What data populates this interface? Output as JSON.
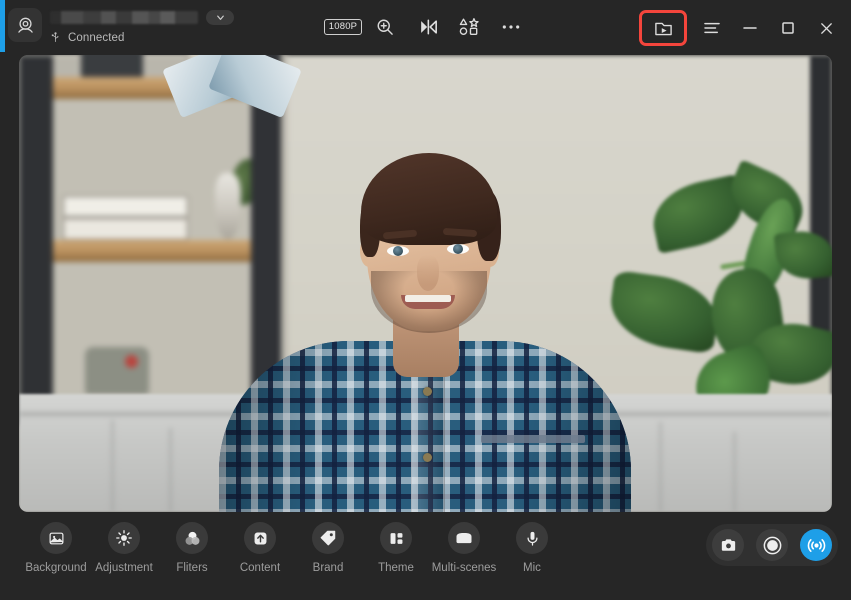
{
  "window": {
    "accent_color": "#1e9fe8",
    "background_color": "#262626",
    "highlight_color": "#f4453c"
  },
  "titlebar": {
    "camera_icon": "webcam-icon",
    "device_name": "",
    "device_name_state": "blurred",
    "device_dropdown_icon": "chevron-down-icon",
    "connection_icon": "usb-icon",
    "connection_status": "Connected",
    "tools": [
      {
        "id": "resolution",
        "label": "1080P",
        "icon": "resolution-badge"
      },
      {
        "id": "zoom",
        "label": "",
        "icon": "magnifier-plus-icon"
      },
      {
        "id": "mirror",
        "label": "",
        "icon": "mirror-flip-icon"
      },
      {
        "id": "shapes",
        "label": "",
        "icon": "shapes-grid-icon"
      },
      {
        "id": "more",
        "label": "",
        "icon": "ellipsis-icon"
      }
    ],
    "window_controls": [
      {
        "id": "preview-window",
        "icon": "video-window-icon",
        "highlighted": true
      },
      {
        "id": "menu",
        "icon": "hamburger-menu-icon",
        "highlighted": false
      },
      {
        "id": "minimize",
        "icon": "minimize-icon",
        "highlighted": false
      },
      {
        "id": "maximize",
        "icon": "maximize-icon",
        "highlighted": false
      },
      {
        "id": "close",
        "icon": "close-icon",
        "highlighted": false
      }
    ]
  },
  "preview": {
    "alt": "Live webcam preview of a smiling man in a blue plaid shirt seated on a light gray couch, with a blurred bookshelf on the left and a green houseplant on the right"
  },
  "bottombar": {
    "features": [
      {
        "label": "Background",
        "icon": "image-icon"
      },
      {
        "label": "Adjustment",
        "icon": "brightness-sun-icon"
      },
      {
        "label": "Fliters",
        "icon": "filters-circles-icon"
      },
      {
        "label": "Content",
        "icon": "upload-arrow-icon"
      },
      {
        "label": "Brand",
        "icon": "tag-icon"
      },
      {
        "label": "Theme",
        "icon": "layout-panels-icon"
      },
      {
        "label": "Multi-scenes",
        "icon": "scenes-card-icon"
      },
      {
        "label": "Mic",
        "icon": "microphone-icon"
      }
    ],
    "actions": [
      {
        "id": "snapshot",
        "icon": "camera-icon",
        "active": false
      },
      {
        "id": "record",
        "icon": "record-circle-icon",
        "active": false
      },
      {
        "id": "broadcast",
        "icon": "broadcast-waves-icon",
        "active": true
      }
    ]
  }
}
